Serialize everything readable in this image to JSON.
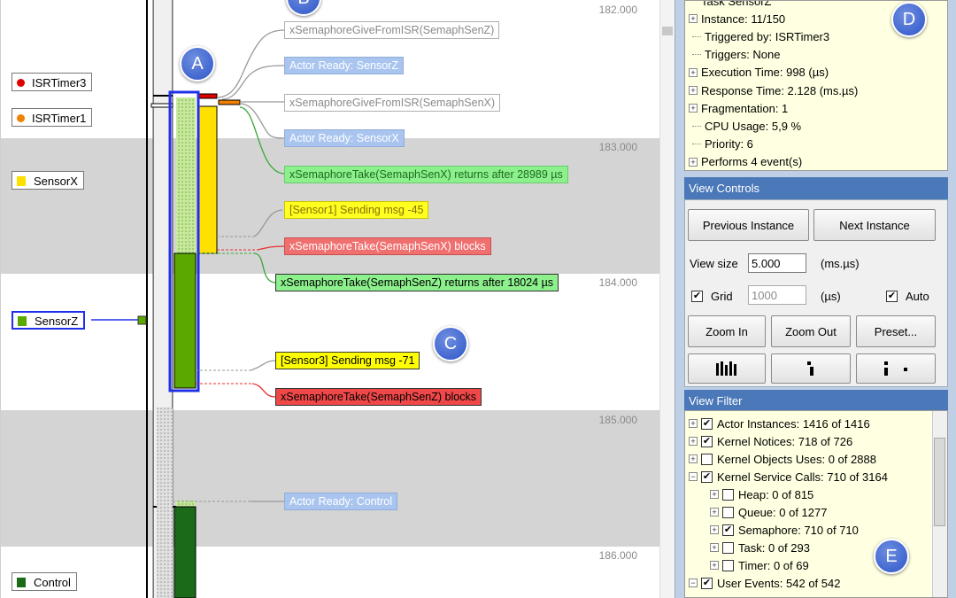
{
  "trace": {
    "time_labels": [
      "182.000",
      "183.000",
      "184.000",
      "185.000",
      "186.000"
    ],
    "actors": [
      {
        "label": "ISRTimer3",
        "color": "#e00000",
        "shape": "dot"
      },
      {
        "label": "ISRTimer1",
        "color": "#f08000",
        "shape": "dot"
      },
      {
        "label": "SensorX",
        "color": "#ffe000",
        "shape": "square"
      },
      {
        "label": "SensorZ",
        "color": "#5aa800",
        "shape": "square"
      },
      {
        "label": "Control",
        "color": "#1a6a1a",
        "shape": "square"
      }
    ],
    "events": [
      {
        "text": "xSemaphoreGiveFromISR(SemaphSenZ)",
        "style": "white"
      },
      {
        "text": "Actor Ready: SensorZ",
        "style": "blue"
      },
      {
        "text": "xSemaphoreGiveFromISR(SemaphSenX)",
        "style": "white"
      },
      {
        "text": "Actor Ready: SensorX",
        "style": "blue"
      },
      {
        "text": "xSemaphoreTake(SemaphSenX) returns after 28989 µs",
        "style": "green"
      },
      {
        "text": "[Sensor1] Sending msg -45",
        "style": "yellow"
      },
      {
        "text": "xSemaphoreTake(SemaphSenX) blocks",
        "style": "red"
      },
      {
        "text": "xSemaphoreTake(SemaphSenZ) returns after 18024 µs",
        "style": "green-b"
      },
      {
        "text": "[Sensor3] Sending msg -71",
        "style": "yellow-b"
      },
      {
        "text": "xSemaphoreTake(SemaphSenZ) blocks",
        "style": "red-b"
      },
      {
        "text": "Actor Ready: Control",
        "style": "blue"
      }
    ],
    "callouts": [
      "A",
      "B",
      "C",
      "D",
      "E"
    ]
  },
  "info": {
    "rows": [
      {
        "text": "Task SensorZ",
        "expand": false
      },
      {
        "text": "Instance: 11/150",
        "expand": true
      },
      {
        "text": "Triggered by: ISRTimer3",
        "expand": false
      },
      {
        "text": "Triggers: None",
        "expand": false
      },
      {
        "text": "Execution Time: 998 (µs)",
        "expand": true
      },
      {
        "text": "Response Time: 2.128 (ms.µs)",
        "expand": true
      },
      {
        "text": "Fragmentation: 1",
        "expand": true
      },
      {
        "text": "CPU Usage: 5,9 %",
        "expand": false
      },
      {
        "text": "Priority: 6",
        "expand": false
      },
      {
        "text": "Performs 4 event(s)",
        "expand": true
      }
    ]
  },
  "view_controls": {
    "header": "View Controls",
    "previous_instance": "Previous Instance",
    "next_instance": "Next Instance",
    "view_size_label": "View size",
    "view_size_value": "5.000",
    "view_size_unit": "(ms.µs)",
    "grid_label": "Grid",
    "grid_checked": true,
    "grid_value": "1000",
    "grid_unit": "(µs)",
    "auto_label": "Auto",
    "auto_checked": true,
    "zoom_in": "Zoom In",
    "zoom_out": "Zoom Out",
    "preset": "Preset..."
  },
  "view_filter": {
    "header": "View Filter",
    "rows": [
      {
        "text": "Actor Instances: 1416 of 1416",
        "checked": true,
        "level": 0,
        "expand": "plus"
      },
      {
        "text": "Kernel Notices: 718 of 726",
        "checked": true,
        "level": 0,
        "expand": "plus"
      },
      {
        "text": "Kernel Objects Uses: 0 of 2888",
        "checked": false,
        "level": 0,
        "expand": "plus"
      },
      {
        "text": "Kernel Service Calls: 710 of 3164",
        "checked": true,
        "level": 0,
        "expand": "minus"
      },
      {
        "text": "Heap: 0 of 815",
        "checked": false,
        "level": 1,
        "expand": "plus"
      },
      {
        "text": "Queue: 0 of 1277",
        "checked": false,
        "level": 1,
        "expand": "plus"
      },
      {
        "text": "Semaphore: 710 of 710",
        "checked": true,
        "level": 1,
        "expand": "plus"
      },
      {
        "text": "Task: 0 of 293",
        "checked": false,
        "level": 1,
        "expand": "plus"
      },
      {
        "text": "Timer: 0 of 69",
        "checked": false,
        "level": 1,
        "expand": "plus"
      },
      {
        "text": "User Events: 542 of 542",
        "checked": true,
        "level": 0,
        "expand": "minus"
      }
    ]
  }
}
